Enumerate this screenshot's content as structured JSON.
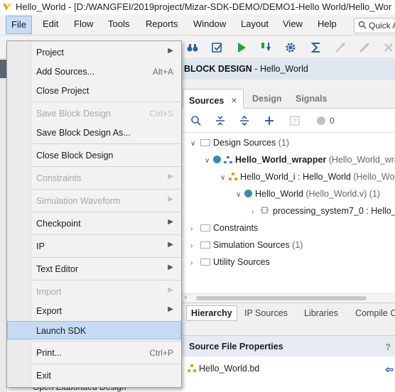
{
  "window": {
    "title": "Hello_World - [D:/WANGFEI/2019project/Mizar-SDK-DEMO/DEMO1-Hello World/Hello_Wor"
  },
  "menubar": {
    "items": [
      "File",
      "Edit",
      "Flow",
      "Tools",
      "Reports",
      "Window",
      "Layout",
      "View",
      "Help"
    ],
    "quick_access": "Quick A"
  },
  "file_menu": {
    "project": "Project",
    "add_sources": "Add Sources...",
    "add_sources_shortcut": "Alt+A",
    "close_project": "Close Project",
    "save_block_design": "Save Block Design",
    "save_block_design_shortcut": "Ctrl+S",
    "save_block_design_as": "Save Block Design As...",
    "close_block_design": "Close Block Design",
    "constraints": "Constraints",
    "simulation_waveform": "Simulation Waveform",
    "checkpoint": "Checkpoint",
    "ip": "IP",
    "text_editor": "Text Editor",
    "import": "Import",
    "export": "Export",
    "launch_sdk": "Launch SDK",
    "print": "Print...",
    "print_shortcut": "Ctrl+P",
    "exit": "Exit"
  },
  "block_design": {
    "header_bold": "BLOCK DESIGN",
    "header_rest": " - Hello_World"
  },
  "sources": {
    "tabs": [
      "Sources",
      "Design",
      "Signals"
    ],
    "close": "×",
    "badge_count": "0",
    "tree": {
      "design_sources": "Design Sources",
      "design_sources_count": " (1)",
      "wrapper": "Hello_World_wrapper",
      "wrapper_file": " (Hello_World_wra",
      "bd_instance": "Hello_World_i : Hello_World",
      "bd_instance_file": " (Hello_Wo",
      "hello_world": "Hello_World",
      "hello_world_file": " (Hello_World.v)",
      "hello_world_count": " (1)",
      "ps7": "processing_system7_0 : Hello_",
      "constraints": "Constraints",
      "simulation_sources": "Simulation Sources",
      "simulation_sources_count": " (1)",
      "utility_sources": "Utility Sources"
    },
    "bottom_tabs": [
      "Hierarchy",
      "IP Sources",
      "Libraries",
      "Compile O"
    ]
  },
  "source_file_properties": {
    "title": "Source File Properties",
    "help": "?",
    "file": "Hello_World.bd"
  },
  "left_panel": {
    "bottom_item": "Open Elaborated Design"
  }
}
